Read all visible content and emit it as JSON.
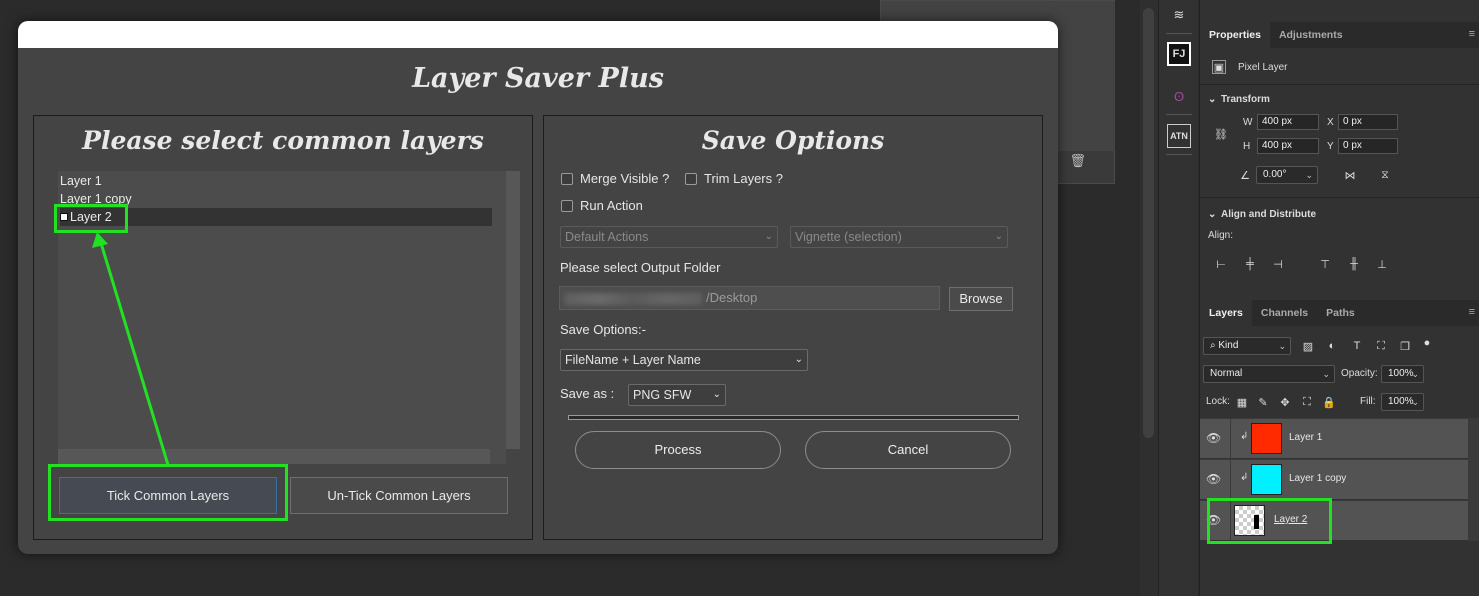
{
  "dialog": {
    "title": "Layer Saver Plus",
    "left_group": {
      "title": "Please select common layers",
      "layers": [
        {
          "label": "Layer 1",
          "selected": false
        },
        {
          "label": "Layer 1 copy",
          "selected": false
        },
        {
          "label": "Layer 2",
          "selected": true
        }
      ],
      "tick_button": "Tick Common Layers",
      "untick_button": "Un-Tick Common Layers"
    },
    "right_group": {
      "title": "Save Options",
      "merge_visible": "Merge Visible ?",
      "trim_layers": "Trim Layers ?",
      "run_action": "Run Action",
      "action_set": "Default Actions",
      "action": "Vignette (selection)",
      "output_folder_label": "Please select Output Folder",
      "output_folder_path": "/Desktop",
      "browse_button": "Browse",
      "save_options_label": "Save Options:-",
      "naming_option": "FileName + Layer Name",
      "save_as_label": "Save as :",
      "save_as_format": "PNG SFW",
      "process_button": "Process",
      "cancel_button": "Cancel"
    }
  },
  "properties_panel": {
    "tabs": [
      "Properties",
      "Adjustments"
    ],
    "layer_type": "Pixel Layer",
    "transform": {
      "title": "Transform",
      "w_label": "W",
      "w": "400 px",
      "x_label": "X",
      "x": "0 px",
      "h_label": "H",
      "h": "400 px",
      "y_label": "Y",
      "y": "0 px",
      "angle": "0.00°"
    },
    "align": {
      "title": "Align and Distribute",
      "label": "Align:"
    }
  },
  "layers_panel": {
    "tabs": [
      "Layers",
      "Channels",
      "Paths"
    ],
    "filter": "Kind",
    "blend_mode": "Normal",
    "opacity_label": "Opacity:",
    "opacity": "100%",
    "lock_label": "Lock:",
    "fill_label": "Fill:",
    "fill": "100%",
    "layers": [
      {
        "name": "Layer 1",
        "color": "#ff2a00"
      },
      {
        "name": "Layer 1 copy",
        "color": "#00f0ff"
      },
      {
        "name": "Layer 2",
        "color": "checker"
      }
    ]
  },
  "colors": {
    "annotation": "#22e022",
    "dialog_bg": "#444444"
  }
}
